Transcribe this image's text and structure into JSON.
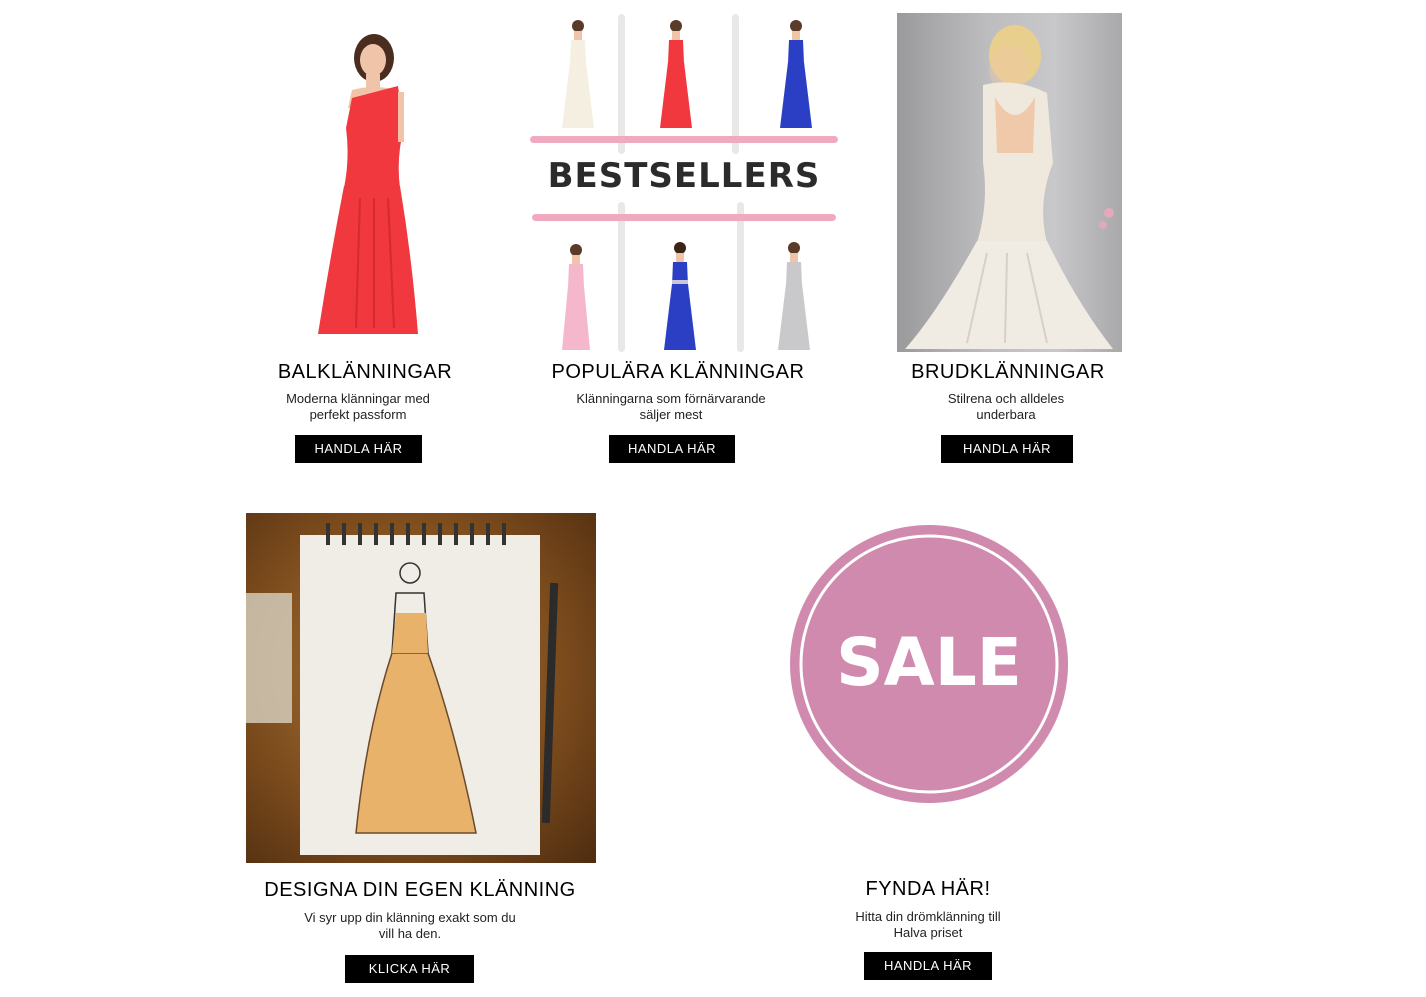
{
  "bestsellers": {
    "heading": "BESTSELLERS"
  },
  "categories": [
    {
      "title": "BALKLÄNNINGAR",
      "desc_line1": "Moderna klänningar med",
      "desc_line2": "perfekt passform",
      "button": "HANDLA HÄR"
    },
    {
      "title": "POPULÄRA KLÄNNINGAR",
      "desc_line1": "Klänningarna som förnärvarande",
      "desc_line2": "säljer mest",
      "button": "HANDLA HÄR"
    },
    {
      "title": "BRUDKLÄNNINGAR",
      "desc_line1": "Stilrena och alldeles",
      "desc_line2": "underbara",
      "button": "HANDLA HÄR"
    }
  ],
  "design": {
    "title": "DESIGNA DIN EGEN KLÄNNING",
    "desc_line1": "Vi syr upp din klänning exakt som du",
    "desc_line2": "vill ha den.",
    "button": "KLICKA HÄR"
  },
  "sale": {
    "badge": "SALE",
    "title": "FYNDA HÄR!",
    "desc_line1": "Hitta din drömklänning till",
    "desc_line2": "Halva priset",
    "button": "HANDLA HÄR"
  },
  "colors": {
    "sale_pink": "#d08aae",
    "bar_pink": "#efaac0",
    "red_dress": "#f0383e",
    "blue_dress": "#2a3fc4"
  }
}
